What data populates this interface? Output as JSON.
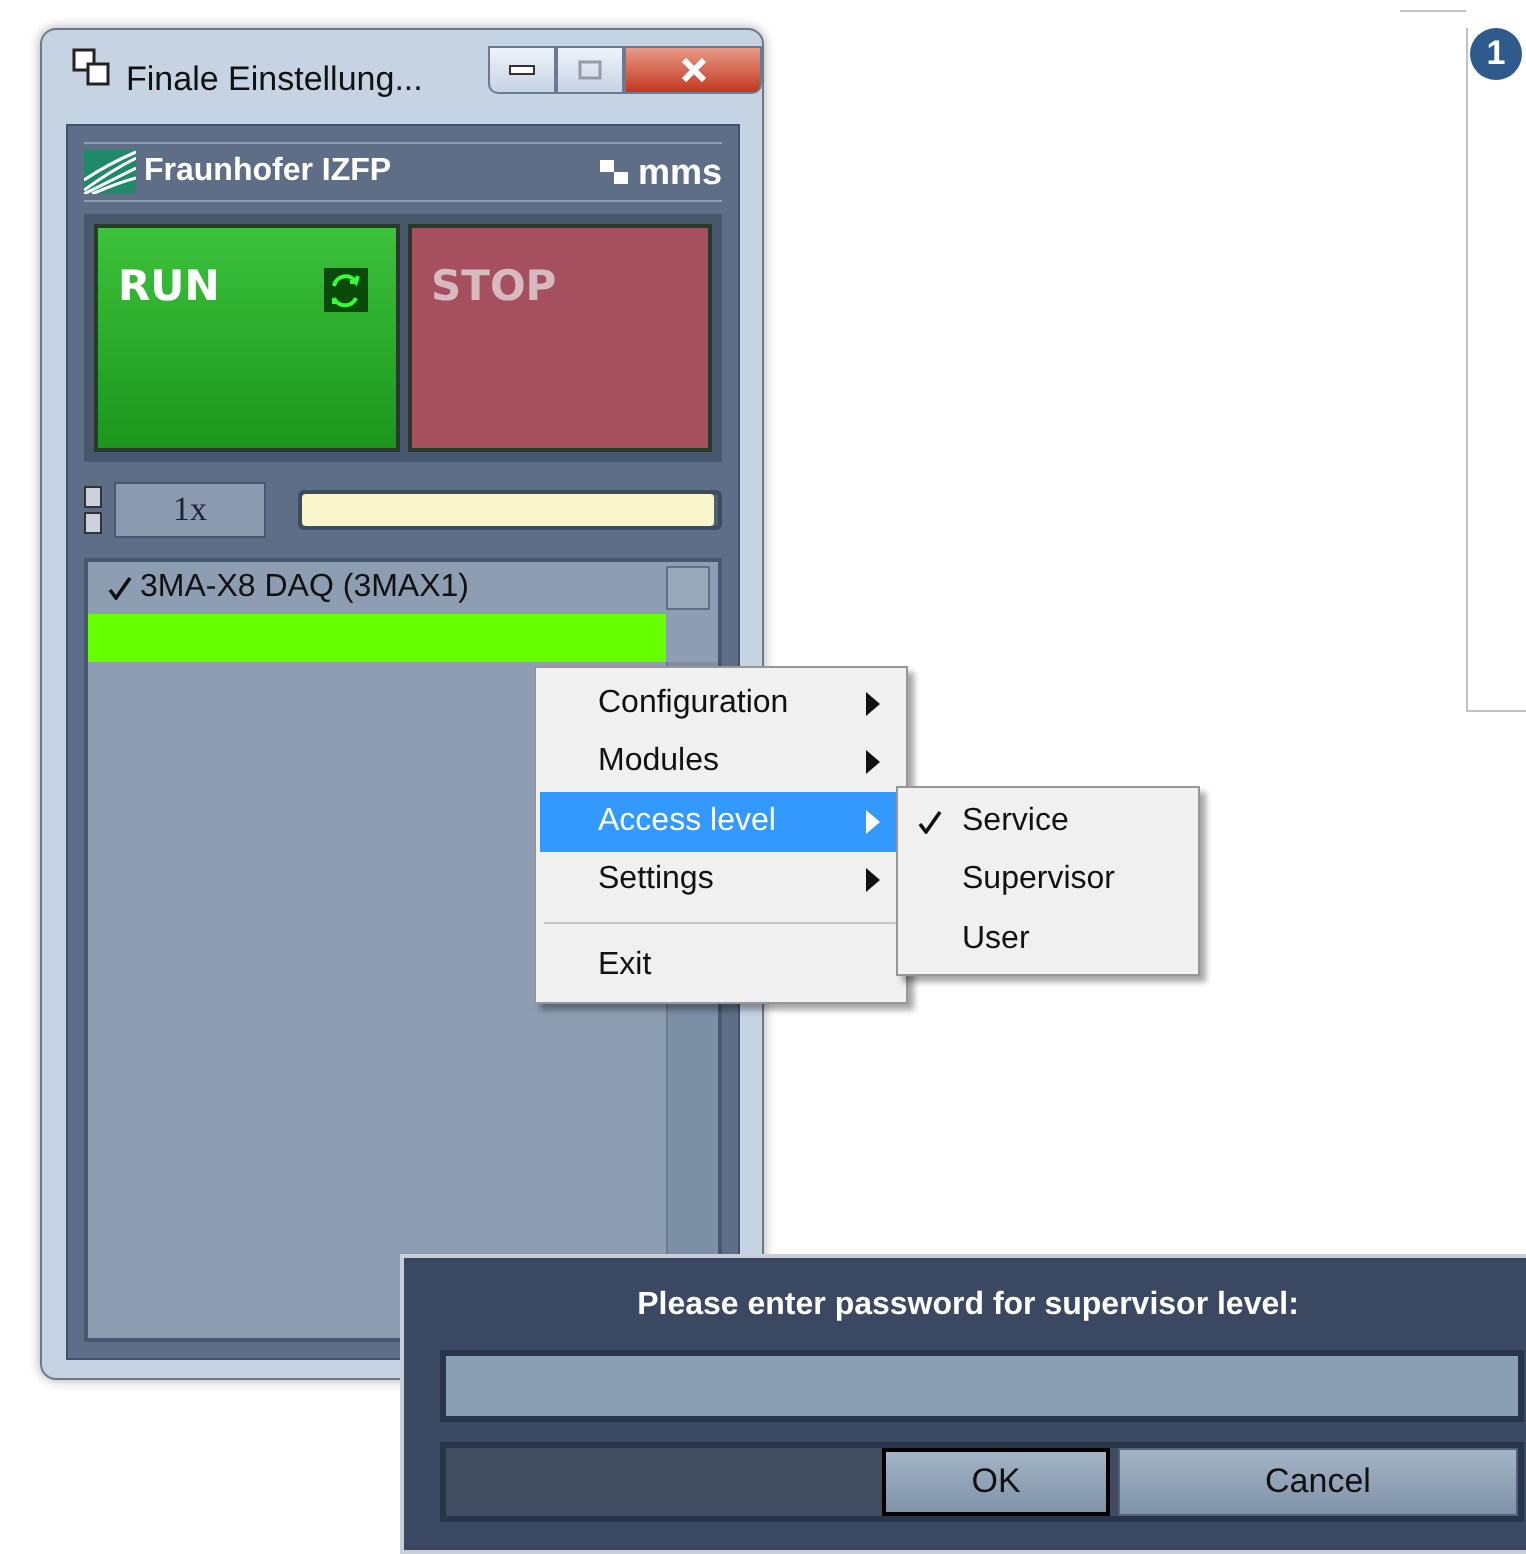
{
  "window": {
    "title": "Finale Einstellung..."
  },
  "header": {
    "brand": "Fraunhofer IZFP",
    "product": "mms"
  },
  "run_button": {
    "label": "RUN",
    "disabled": false
  },
  "stop_button": {
    "label": "STOP",
    "disabled": true
  },
  "speed": {
    "value": "1x"
  },
  "progress": {
    "level": 0.99
  },
  "devices": [
    {
      "name": "3MA-X8 DAQ (3MAX1)",
      "checked": true
    }
  ],
  "context_menu": {
    "items": [
      {
        "kind": "item",
        "label": "Configuration",
        "submenu": true,
        "selected": false
      },
      {
        "kind": "item",
        "label": "Modules",
        "submenu": true,
        "selected": false
      },
      {
        "kind": "item",
        "label": "Access level",
        "submenu": true,
        "selected": true
      },
      {
        "kind": "item",
        "label": "Settings",
        "submenu": true,
        "selected": false
      },
      {
        "kind": "separator"
      },
      {
        "kind": "item",
        "label": "Exit",
        "submenu": false,
        "selected": false
      }
    ]
  },
  "submenu": {
    "items": [
      {
        "label": "Service",
        "checked": true
      },
      {
        "label": "Supervisor",
        "checked": false
      },
      {
        "label": "User",
        "checked": false
      }
    ]
  },
  "callout": {
    "number": "1"
  },
  "password_dialog": {
    "prompt": "Please enter password for supervisor level:",
    "buttons": [
      {
        "label": "OK",
        "default": true
      },
      {
        "label": "Cancel",
        "default": false
      }
    ]
  }
}
